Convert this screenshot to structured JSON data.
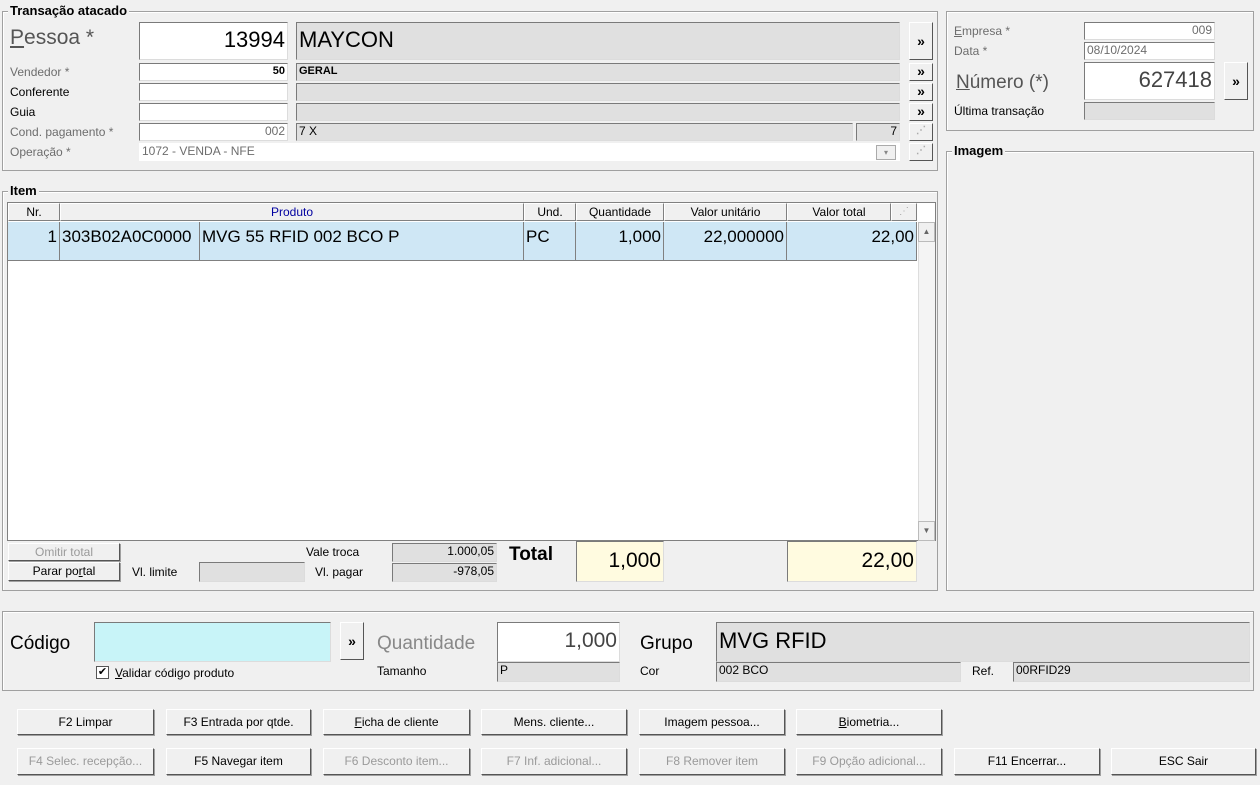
{
  "transacao": {
    "legend": "Transação atacado",
    "pessoa_label": "Pessoa *",
    "pessoa_code": "13994",
    "pessoa_name": "MAYCON",
    "vendedor_label": "Vendedor *",
    "vendedor_code": "50",
    "vendedor_name": "GERAL",
    "conferente_label": "Conferente",
    "guia_label": "Guia",
    "cond_label": "Cond. pagamento *",
    "cond_code": "002",
    "cond_name": "7 X",
    "cond_num": "7",
    "operacao_label": "Operação *",
    "operacao_value": "1072 - VENDA - NFE",
    "arrow": "»"
  },
  "empresa": {
    "empresa_label": "Empresa *",
    "empresa_value": "009",
    "data_label": "Data *",
    "data_value": "08/10/2024",
    "numero_label": "Número (*)",
    "numero_value": "627418",
    "ultima_label": "Última transação"
  },
  "imagem": {
    "legend": "Imagem"
  },
  "item": {
    "legend": "Item",
    "columns": [
      "Nr.",
      "Produto",
      "Und.",
      "Quantidade",
      "Valor unitário",
      "Valor total"
    ],
    "rows": [
      {
        "nr": "1",
        "codigo": "303B02A0C0000",
        "produto": "MVG 55 RFID 002 BCO P",
        "und": "PC",
        "quantidade": "1,000",
        "valor_unitario": "22,000000",
        "valor_total": "22,00"
      }
    ],
    "omitir_total": "Omitir total",
    "parar_portal": "Parar portal",
    "vl_limite_label": "Vl. limite",
    "vale_troca_label": "Vale troca",
    "vale_troca_value": "1.000,05",
    "vl_pagar_label": "Vl. pagar",
    "vl_pagar_value": "-978,05",
    "total_label": "Total",
    "total_qtd": "1,000",
    "total_valor": "22,00"
  },
  "entrada": {
    "codigo_label": "Código",
    "validar_label": "Validar código produto",
    "quantidade_label": "Quantidade",
    "quantidade_value": "1,000",
    "tamanho_label": "Tamanho",
    "tamanho_value": "P",
    "grupo_label": "Grupo",
    "grupo_value": "MVG RFID",
    "cor_label": "Cor",
    "cor_value": "002 BCO",
    "ref_label": "Ref.",
    "ref_value": "00RFID29"
  },
  "buttons_row1": [
    "F2 Limpar",
    "F3 Entrada por qtde.",
    "Ficha de cliente",
    "Mens. cliente...",
    "Imagem pessoa...",
    "Biometria..."
  ],
  "buttons_row2": [
    "F4 Selec. recepção...",
    "F5 Navegar item",
    "F6 Desconto item...",
    "F7 Inf. adicional...",
    "F8 Remover item",
    "F9 Opção adicional...",
    "F11 Encerrar...",
    "ESC Sair"
  ],
  "colors": {
    "row_selected": "#cfe7f5",
    "codigo_input": "#c8f4f8",
    "total_bg": "#fffbe0"
  }
}
